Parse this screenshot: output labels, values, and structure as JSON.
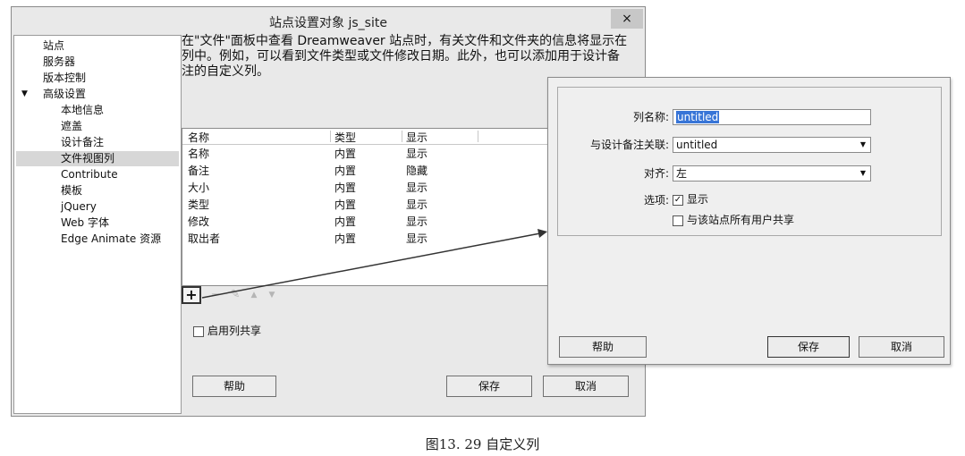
{
  "main_dialog": {
    "title": "站点设置对象 js_site",
    "close_label": "×",
    "sidebar": {
      "items": [
        {
          "label": "站点"
        },
        {
          "label": "服务器"
        },
        {
          "label": "版本控制"
        },
        {
          "label": "高级设置",
          "expanded": true,
          "toggle": "▼"
        },
        {
          "label": "本地信息"
        },
        {
          "label": "遮盖"
        },
        {
          "label": "设计备注"
        },
        {
          "label": "文件视图列",
          "selected": true
        },
        {
          "label": "Contribute"
        },
        {
          "label": "模板"
        },
        {
          "label": "jQuery"
        },
        {
          "label": "Web 字体"
        },
        {
          "label": "Edge Animate 资源"
        }
      ]
    },
    "description": "在\"文件\"面板中查看 Dreamweaver 站点时，有关文件和文件夹的信息将显示在列中。例如，可以看到文件类型或文件修改日期。此外，也可以添加用于设计备注的自定义列。",
    "table": {
      "headers": [
        "名称",
        "类型",
        "显示"
      ],
      "rows": [
        [
          "名称",
          "内置",
          "显示"
        ],
        [
          "备注",
          "内置",
          "隐藏"
        ],
        [
          "大小",
          "内置",
          "显示"
        ],
        [
          "类型",
          "内置",
          "显示"
        ],
        [
          "修改",
          "内置",
          "显示"
        ],
        [
          "取出者",
          "内置",
          "显示"
        ]
      ]
    },
    "toolbar": {
      "add": "+",
      "remove": "−",
      "edit": "✎",
      "up": "▲",
      "down": "▼"
    },
    "enable_sharing_label": "启用列共享",
    "enable_sharing_checked": false,
    "help_button": "帮助",
    "save_button": "保存",
    "cancel_button": "取消"
  },
  "column_dialog": {
    "name_label": "列名称:",
    "name_value": "untitled",
    "assoc_label": "与设计备注关联:",
    "assoc_value": "untitled",
    "align_label": "对齐:",
    "align_value": "左",
    "options_label": "选项:",
    "show_label": "显示",
    "show_checked": true,
    "share_label": "与该站点所有用户共享",
    "share_checked": false,
    "help_button": "帮助",
    "save_button": "保存",
    "cancel_button": "取消"
  },
  "caption": "图13. 29   自定义列"
}
